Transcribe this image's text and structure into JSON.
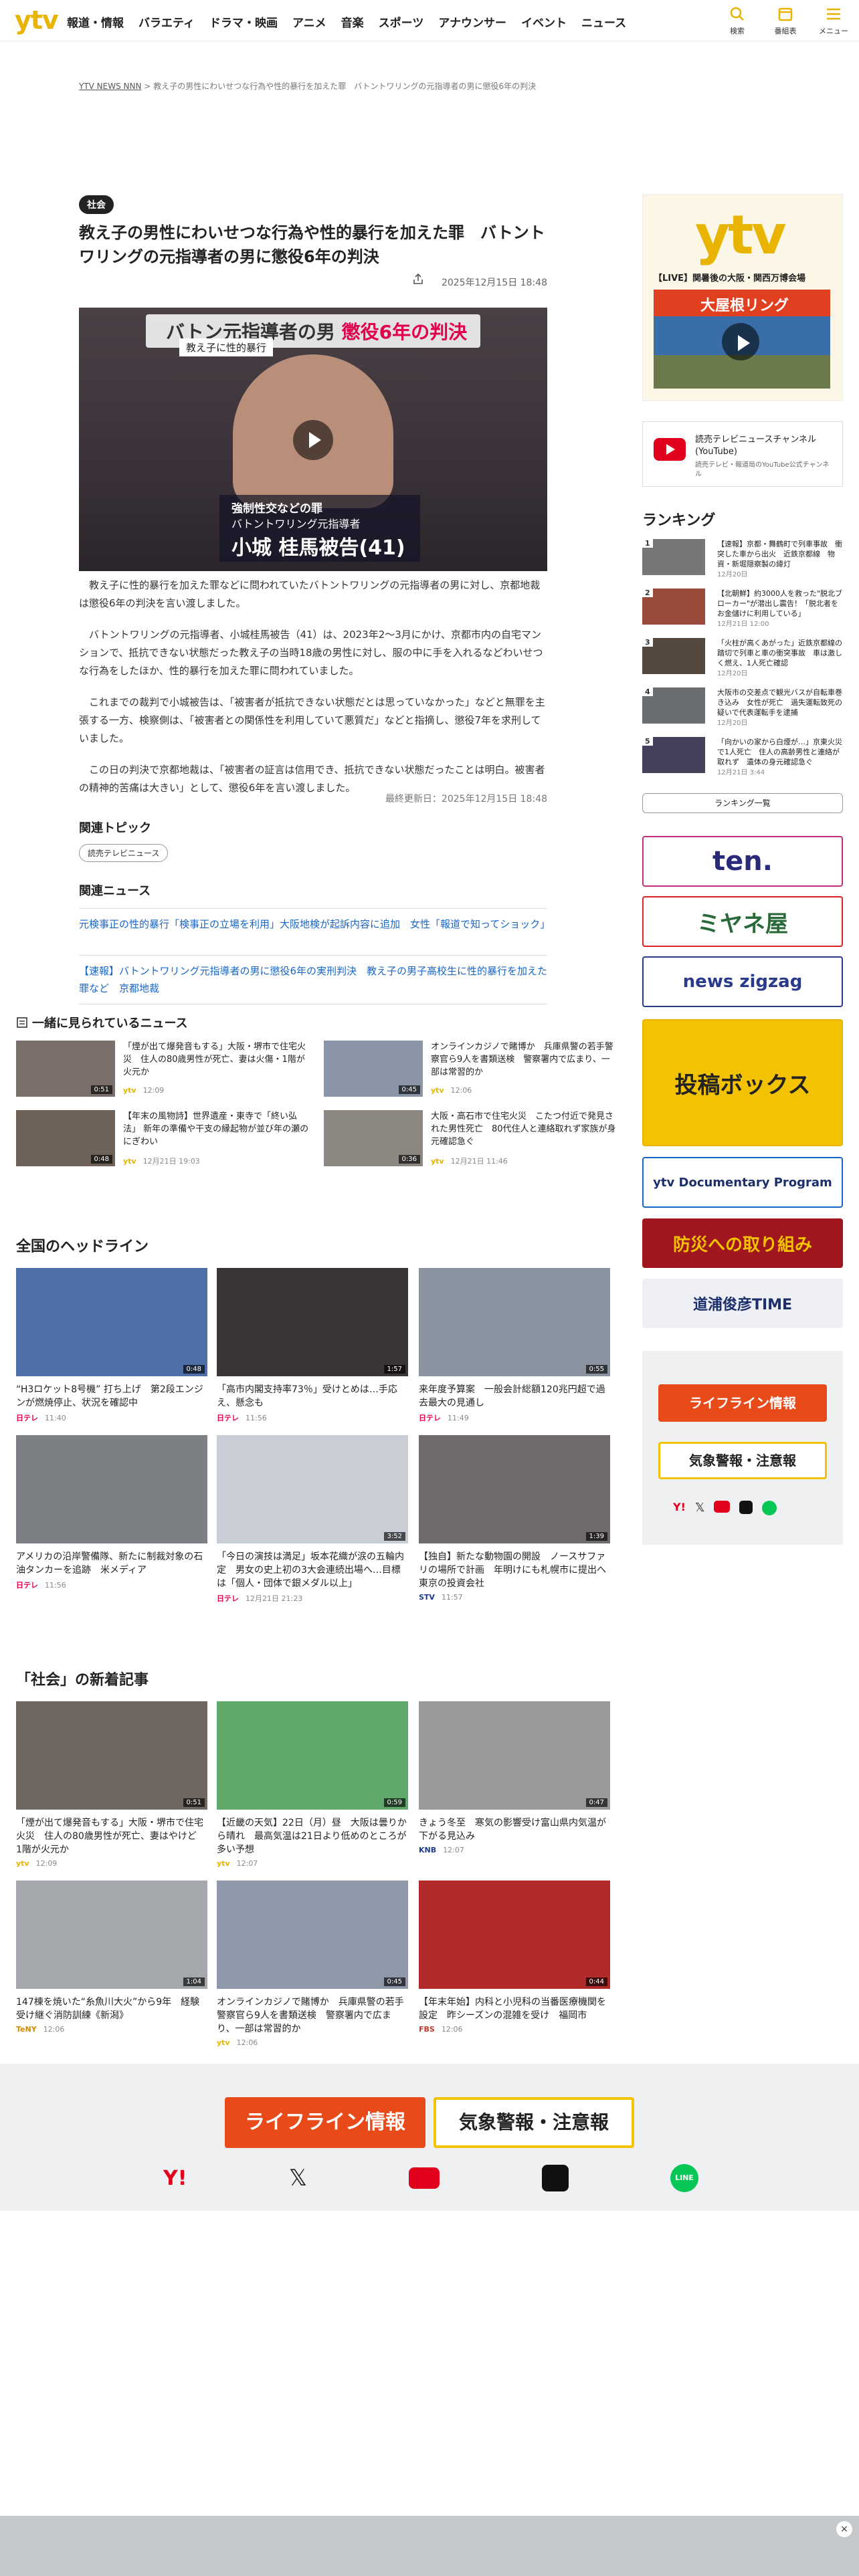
{
  "header": {
    "logo": "ytv",
    "nav": [
      "報道・情報",
      "バラエティ",
      "ドラマ・映画",
      "アニメ",
      "音楽",
      "スポーツ",
      "アナウンサー",
      "イベント",
      "ニュース"
    ],
    "icons": [
      {
        "name": "search-icon",
        "label": "検索"
      },
      {
        "name": "calendar-icon",
        "label": "番組表"
      },
      {
        "name": "menu-icon",
        "label": "メニュー"
      }
    ]
  },
  "breadcrumb": {
    "home": "YTV NEWS NNN",
    "sep": ">",
    "current": "教え子の男性にわいせつな行為や性的暴行を加えた罪　バトントワリングの元指導者の男に懲役6年の判決"
  },
  "article": {
    "category": "社会",
    "title": "教え子の男性にわいせつな行為や性的暴行を加えた罪　バトントワリングの元指導者の男に懲役6年の判決",
    "date": "2025年12月15日 18:48",
    "video": {
      "banner": "バトン元指導者の男",
      "banner_red": "懲役6年の判決",
      "sub": "教え子に性的暴行",
      "caption1": "強制性交などの罪",
      "caption2": "バトントワリング元指導者",
      "caption3": "小城 桂馬被告(41)"
    },
    "paragraphs": [
      "教え子に性的暴行を加えた罪などに問われていたバトントワリングの元指導者の男に対し、京都地裁は懲役6年の判決を言い渡しました。",
      "バトントワリングの元指導者、小城桂馬被告（41）は、2023年2～3月にかけ、京都市内の自宅マンションで、抵抗できない状態だった教え子の当時18歳の男性に対し、服の中に手を入れるなどわいせつな行為をしたほか、性的暴行を加えた罪に問われていました。",
      "これまでの裁判で小城被告は、「被害者が抵抗できない状態だとは思っていなかった」などと無罪を主張する一方、検察側は、「被害者との関係性を利用していて悪質だ」などと指摘し、懲役7年を求刑していました。",
      "この日の判決で京都地裁は、「被害者の証言は信用でき、抵抗できない状態だったことは明白。被害者の精神的苦痛は大きい」として、懲役6年を言い渡しました。"
    ],
    "updated": "最終更新日：2025年12月15日 18:48"
  },
  "related_topics": {
    "heading": "関連トピック",
    "tags": [
      "読売テレビニュース"
    ]
  },
  "related_news": {
    "heading": "関連ニュース",
    "items": [
      "元検事正の性的暴行「検事正の立場を利用」大阪地検が起訴内容に追加　女性「報道で知ってショック」",
      "【速報】バトントワリング元指導者の男に懲役6年の実刑判決　教え子の男子高校生に性的暴行を加えた罪など　京都地裁"
    ]
  },
  "popular": {
    "heading": "一緒に見られているニュース",
    "items": [
      {
        "text": "「煙が出て爆発音もする」大阪・堺市で住宅火災　住人の80歳男性が死亡、妻は火傷・1階が火元か",
        "brand": "ytv",
        "time": "12:09",
        "dur": "0:51"
      },
      {
        "text": "オンラインカジノで賭博か　兵庫県警の若手警察官ら9人を書類送検　警察署内で広まり、一部は常習的か",
        "brand": "ytv",
        "time": "12:06",
        "dur": "0:45"
      },
      {
        "text": "【年末の風物詩】世界遺産・東寺で「終い弘法」 新年の準備や干支の縁起物が並び年の瀬のにぎわい",
        "brand": "ytv",
        "time": "12月21日 19:03",
        "dur": "0:48"
      },
      {
        "text": "大阪・高石市で住宅火災　こたつ付近で発見された男性死亡　80代住人と連絡取れず家族が身元確認急ぐ",
        "brand": "ytv",
        "time": "12月21日 11:46",
        "dur": "0:36"
      }
    ]
  },
  "national": {
    "heading": "全国のヘッドライン",
    "items": [
      {
        "text": "“H3ロケット8号機” 打ち上げ　第2段エンジンが燃焼停止、状況を確認中",
        "brand": "日テレ",
        "time": "11:40",
        "dur": "0:48"
      },
      {
        "text": "「高市内閣支持率73％」受けとめは…手応え、懸念も",
        "brand": "日テレ",
        "time": "11:56",
        "dur": "1:57"
      },
      {
        "text": "来年度予算案　一般会計総額120兆円超で過去最大の見通し",
        "brand": "日テレ",
        "time": "11:49",
        "dur": "0:55"
      },
      {
        "text": "アメリカの沿岸警備隊、新たに制裁対象の石油タンカーを追跡　米メディア",
        "brand": "日テレ",
        "time": "11:56",
        "dur": ""
      },
      {
        "text": "「今日の演技は満足」坂本花織が涙の五輪内定　男女の史上初の3大会連続出場へ…目標は「個人・団体で銀メダル以上」",
        "brand": "日テレ",
        "time": "12月21日 21:23",
        "dur": "3:52"
      },
      {
        "text": "【独自】新たな動物園の開設　ノースサファリの場所で計画　年明けにも札幌市に提出へ　東京の投資会社",
        "brand": "STV",
        "time": "11:57",
        "dur": "1:39"
      }
    ]
  },
  "social": {
    "heading": "「社会」の新着記事",
    "items": [
      {
        "text": "「煙が出て爆発音もする」大阪・堺市で住宅火災　住人の80歳男性が死亡、妻はやけど　1階が火元か",
        "brand": "ytv",
        "time": "12:09",
        "dur": "0:51"
      },
      {
        "text": "【近畿の天気】22日（月）昼　大阪は曇りから晴れ　最高気温は21日より低めのところが多い予想",
        "brand": "ytv",
        "time": "12:07",
        "dur": "0:59"
      },
      {
        "text": "きょう冬至　寒気の影響受け富山県内気温が下がる見込み",
        "brand": "KNB",
        "time": "12:07",
        "dur": "0:47"
      },
      {
        "text": "147棟を焼いた“糸魚川大火”から9年　経験受け継ぐ消防訓練《新潟》",
        "brand": "TeNY",
        "time": "12:06",
        "dur": "1:04"
      },
      {
        "text": "オンラインカジノで賭博か　兵庫県警の若手警察官ら9人を書類送検　警察署内で広まり、一部は常習的か",
        "brand": "ytv",
        "time": "12:06",
        "dur": "0:45"
      },
      {
        "text": "【年末年始】内科と小児科の当番医療機関を設定　昨シーズンの混雑を受け　福岡市",
        "brand": "FBS",
        "time": "12:06",
        "dur": "0:44"
      }
    ]
  },
  "sidebar": {
    "live_title": "【LIVE】関暑後の大阪・関西万博会場",
    "live_caption": "大屋根リング",
    "youtube_title": "読売テレビニュースチャンネル(YouTube)",
    "youtube_sub": "読売テレビ・報道局のYouTube公式チャンネル",
    "ranking_heading": "ランキング",
    "ranking": [
      {
        "text": "【速報】京都・舞鶴町で列車事故　衝突した車から出火　近鉄京都線　物資・新堀隠察製の緯灯",
        "time": "12月20日"
      },
      {
        "text": "【北朝鮮】約3000人を救った\"脱北ブローカー\"が潜出し震告！「脱北者をお金儲けに利用している」",
        "time": "12月21日 12:00"
      },
      {
        "text": "「火柱が高くあがった」近鉄京都線の踏切で列車と車の衝突事故　車は激しく燃え、1人死亡確認",
        "time": "12月20日"
      },
      {
        "text": "大阪市の交差点で観光バスが自転車巻き込み　女性が死亡　過失運転致死の疑いで代表運転手を逮捕",
        "time": "12月20日"
      },
      {
        "text": "「向かいの家から白煙が…」京東火災で1人死亡　住人の高齢男性と連絡が取れず　遺体の身元確認急ぐ",
        "time": "12月21日 3:44"
      }
    ],
    "ranking_button": "ランキング一覧",
    "banners": [
      "ten.",
      "ミヤネ屋",
      "news zigzag",
      "投稿ボックス",
      "ytv Documentary Program",
      "防災への取り組み",
      "道浦俊彦TIME"
    ],
    "lifeline": "ライフライン情報",
    "weather": "気象警報・注意報"
  },
  "footer": {
    "lifeline": "ライフライン情報",
    "weather": "気象警報・注意報",
    "social": [
      "Yahoo!",
      "X",
      "YouTube",
      "TikTok",
      "LINE"
    ]
  },
  "colors": {
    "brand": "#e8b400",
    "red": "#d9261c",
    "link": "#1866c6"
  }
}
